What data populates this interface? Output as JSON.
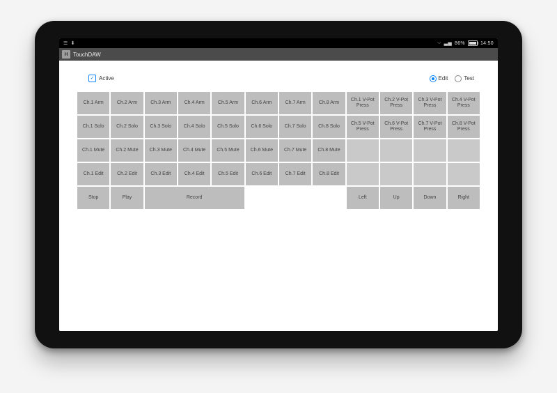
{
  "status": {
    "battery": "86%",
    "time": "14:50"
  },
  "app": {
    "title": "TouchDAW"
  },
  "options": {
    "active_label": "Active",
    "active_checked": true,
    "mode_edit": "Edit",
    "mode_test": "Test",
    "mode_selected": "Edit"
  },
  "grid": {
    "cols": 12,
    "rows": 5,
    "cells": [
      [
        {
          "t": "Ch.1 Arm"
        },
        {
          "t": "Ch.2 Arm"
        },
        {
          "t": "Ch.3 Arm"
        },
        {
          "t": "Ch.4 Arm"
        },
        {
          "t": "Ch.5 Arm"
        },
        {
          "t": "Ch.6 Arm"
        },
        {
          "t": "Ch.7 Arm"
        },
        {
          "t": "Ch.8 Arm"
        },
        {
          "t": "Ch.1 V-Pot Press"
        },
        {
          "t": "Ch.2 V-Pot Press"
        },
        {
          "t": "Ch.3 V-Pot Press"
        },
        {
          "t": "Ch.4 V-Pot Press"
        }
      ],
      [
        {
          "t": "Ch.1 Solo"
        },
        {
          "t": "Ch.2 Solo"
        },
        {
          "t": "Ch.3 Solo"
        },
        {
          "t": "Ch.4 Solo"
        },
        {
          "t": "Ch.5 Solo"
        },
        {
          "t": "Ch.6 Solo"
        },
        {
          "t": "Ch.7 Solo"
        },
        {
          "t": "Ch.8 Solo"
        },
        {
          "t": "Ch.5 V-Pot Press"
        },
        {
          "t": "Ch.6 V-Pot Press"
        },
        {
          "t": "Ch.7 V-Pot Press"
        },
        {
          "t": "Ch.8 V-Pot Press"
        }
      ],
      [
        {
          "t": "Ch.1 Mute"
        },
        {
          "t": "Ch.2 Mute"
        },
        {
          "t": "Ch.3 Mute"
        },
        {
          "t": "Ch.4 Mute"
        },
        {
          "t": "Ch.5 Mute"
        },
        {
          "t": "Ch.6 Mute"
        },
        {
          "t": "Ch.7 Mute"
        },
        {
          "t": "Ch.8 Mute"
        },
        {
          "t": "",
          "empty": true
        },
        {
          "t": "",
          "empty": true
        },
        {
          "t": "",
          "empty": true
        },
        {
          "t": "",
          "empty": true
        }
      ],
      [
        {
          "t": "Ch.1 Edit"
        },
        {
          "t": "Ch.2 Edit"
        },
        {
          "t": "Ch.3 Edit"
        },
        {
          "t": "Ch.4 Edit"
        },
        {
          "t": "Ch.5 Edit"
        },
        {
          "t": "Ch.6 Edit"
        },
        {
          "t": "Ch.7 Edit"
        },
        {
          "t": "Ch.8 Edit"
        },
        {
          "t": "",
          "empty": true
        },
        {
          "t": "",
          "empty": true
        },
        {
          "t": "",
          "empty": true
        },
        {
          "t": "",
          "empty": true
        }
      ],
      [
        {
          "t": "Stop"
        },
        {
          "t": "Play"
        },
        {
          "t": "Record",
          "span": 3
        },
        {
          "t": "",
          "blank": true
        },
        {
          "t": "",
          "blank": true
        },
        {
          "t": "",
          "blank": true
        },
        {
          "t": "Left"
        },
        {
          "t": "Up"
        },
        {
          "t": "Down"
        },
        {
          "t": "Right"
        }
      ]
    ]
  }
}
